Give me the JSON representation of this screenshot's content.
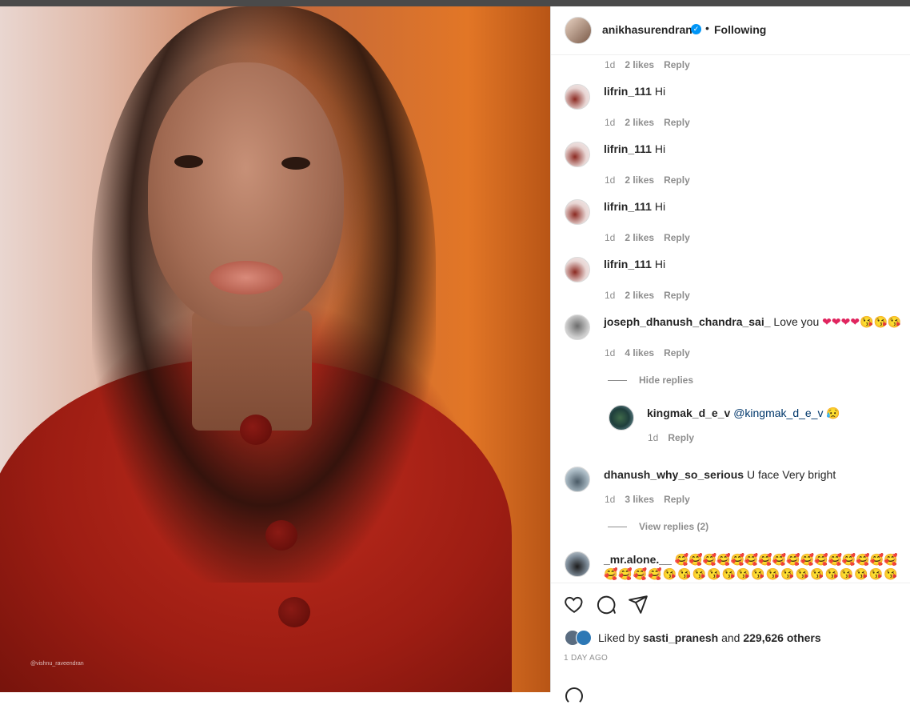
{
  "post": {
    "username": "anikhasurendran",
    "separator": "•",
    "follow_state": "Following",
    "photo_credit": "@vishnu_raveendran"
  },
  "comments": [
    {
      "meta_time": "1d",
      "meta_likes": "2 likes",
      "reply": "Reply"
    },
    {
      "user": "lifrin_111",
      "text": "Hi",
      "time": "1d",
      "likes": "2 likes",
      "reply": "Reply"
    },
    {
      "user": "lifrin_111",
      "text": "Hi",
      "time": "1d",
      "likes": "2 likes",
      "reply": "Reply"
    },
    {
      "user": "lifrin_111",
      "text": "Hi",
      "time": "1d",
      "likes": "2 likes",
      "reply": "Reply"
    },
    {
      "user": "lifrin_111",
      "text": "Hi",
      "time": "1d",
      "likes": "2 likes",
      "reply": "Reply"
    },
    {
      "user": "joseph_dhanush_chandra_sai_",
      "text": "Love you",
      "emojis": "❤❤❤❤😘😘😘",
      "time": "1d",
      "likes": "4 likes",
      "reply": "Reply",
      "toggle": "Hide replies"
    },
    {
      "user": "kingmak_d_e_v",
      "mention": "@kingmak_d_e_v",
      "emojis": "😥",
      "time": "1d",
      "reply": "Reply"
    },
    {
      "user": "dhanush_why_so_serious",
      "text": "U face Very bright",
      "time": "1d",
      "likes": "3 likes",
      "reply": "Reply",
      "toggle": "View replies (2)"
    },
    {
      "user": "_mr.alone.__",
      "emojis_line1": "🥰🥰🥰🥰🥰🥰🥰🥰🥰🥰🥰🥰🥰🥰🥰🥰",
      "emojis_line2": "🥰🥰🥰🥰😘😘😘😘😘😘😘😘😘😘😘😘😘😘😘😘",
      "emojis_line3": "😘😘😘😘"
    }
  ],
  "footer": {
    "liked_prefix": "Liked by",
    "liked_user": "sasti_pranesh",
    "liked_and": "and",
    "liked_others": "229,626 others",
    "timestamp": "1 DAY AGO"
  }
}
